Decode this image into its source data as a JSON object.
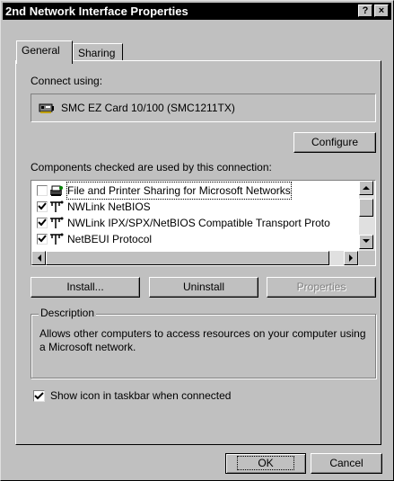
{
  "window": {
    "title": "2nd Network Interface Properties",
    "help_label": "?",
    "close_label": "×"
  },
  "tabs": [
    {
      "label": "General",
      "active": true
    },
    {
      "label": "Sharing",
      "active": false
    }
  ],
  "connect": {
    "label": "Connect using:",
    "adapter": "SMC EZ Card 10/100 (SMC1211TX)",
    "configure_label": "Configure"
  },
  "components": {
    "label": "Components checked are used by this connection:",
    "items": [
      {
        "label": "File and Printer Sharing for Microsoft Networks",
        "checked": false,
        "icon": "file-printer-sharing-icon"
      },
      {
        "label": "NWLink NetBIOS",
        "checked": true,
        "icon": "network-protocol-icon"
      },
      {
        "label": "NWLink IPX/SPX/NetBIOS Compatible Transport Proto",
        "checked": true,
        "icon": "network-protocol-icon"
      },
      {
        "label": "NetBEUI Protocol",
        "checked": true,
        "icon": "network-protocol-icon"
      }
    ]
  },
  "buttons": {
    "install": "Install...",
    "uninstall": "Uninstall",
    "properties": "Properties"
  },
  "description": {
    "label": "Description",
    "text": "Allows other computers to access resources on your computer using a Microsoft network."
  },
  "show_icon": {
    "label": "Show icon in taskbar when connected",
    "checked": true
  },
  "footer": {
    "ok": "OK",
    "cancel": "Cancel"
  }
}
